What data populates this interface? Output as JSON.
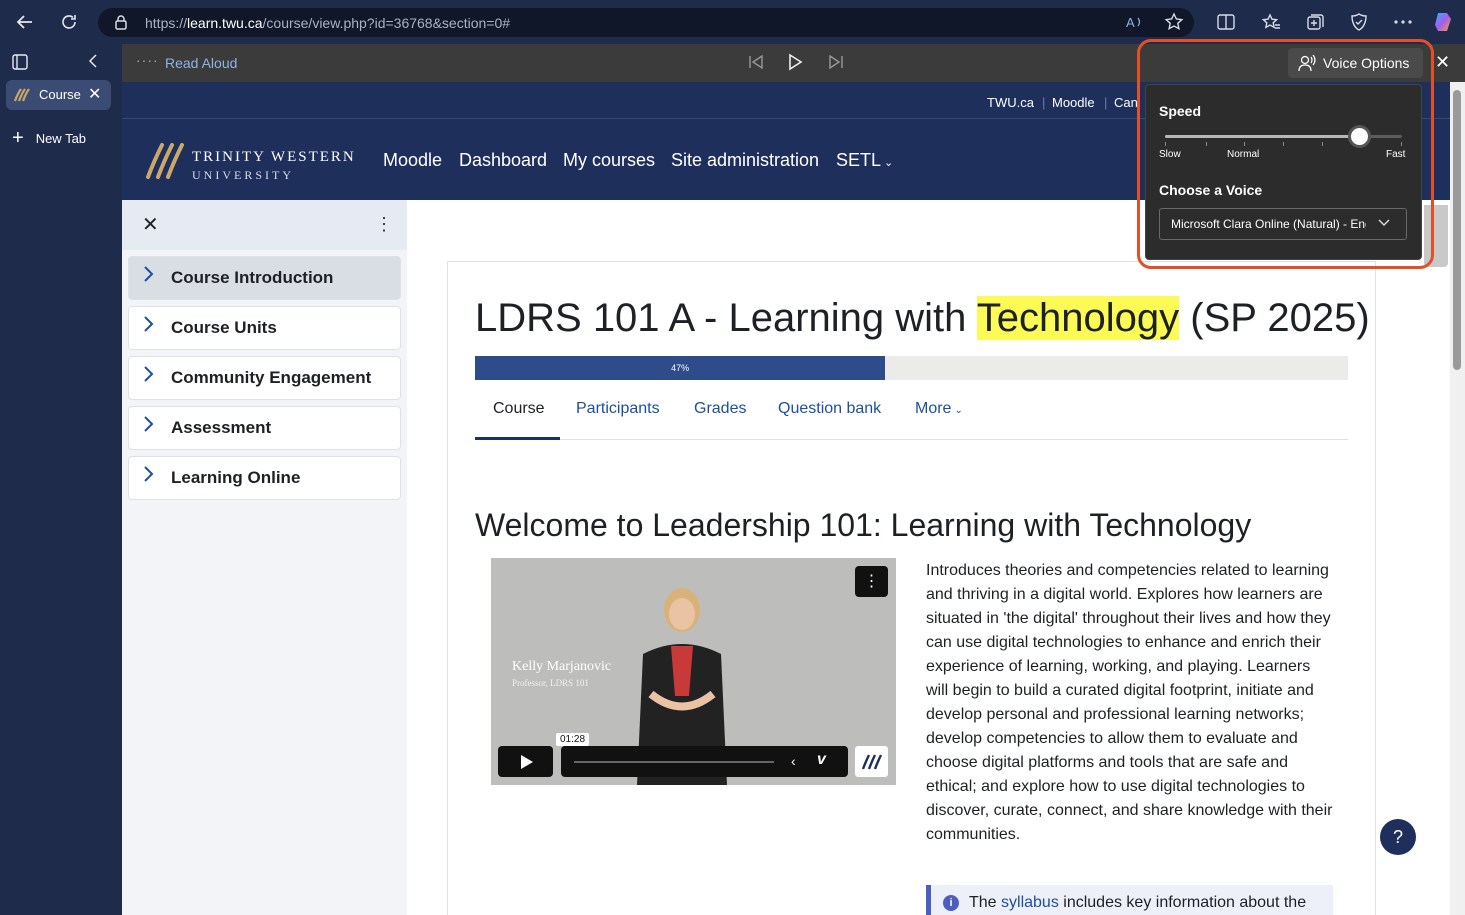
{
  "browser": {
    "url_prefix": "https://",
    "url_host": "learn.twu.ca",
    "url_path": "/course/view.php?id=36768&section=0#",
    "tabs": [
      {
        "label": "Course"
      }
    ],
    "new_tab_label": "New Tab"
  },
  "read_aloud": {
    "label": "Read Aloud",
    "voice_options_label": "Voice Options",
    "speed_label": "Speed",
    "speed_value": 0.82,
    "speed_marks": {
      "slow": "Slow",
      "normal": "Normal",
      "fast": "Fast"
    },
    "choose_voice_label": "Choose a Voice",
    "selected_voice": "Microsoft Clara Online (Natural) - English (Canada)"
  },
  "moodle": {
    "utility_links": [
      "TWU.ca",
      "Moodle",
      "Can"
    ],
    "logo_line1": "TRINITY WESTERN",
    "logo_line2": "UNIVERSITY",
    "nav": [
      "Moodle",
      "Dashboard",
      "My courses",
      "Site administration",
      "SETL"
    ],
    "course_index": [
      "Course Introduction",
      "Course Units",
      "Community Engagement",
      "Assessment",
      "Learning Online"
    ],
    "course_title_before": "LDRS 101 A - Learning with ",
    "course_title_highlight": "Technology",
    "course_title_after": " (SP 2025)",
    "progress_percent": 47,
    "progress_label": "47%",
    "tabs": [
      "Course",
      "Participants",
      "Grades",
      "Question bank",
      "More"
    ],
    "welcome_heading": "Welcome to Leadership 101: Learning with Technology",
    "video": {
      "presenter_name": "Kelly Marjanovic",
      "presenter_role": "Professor, LDRS 101",
      "time": "01:28"
    },
    "description": "Introduces theories and competencies related to learning and thriving in a digital world. Explores how learners are situated in 'the digital' throughout their lives and how they can use digital technologies to enhance and enrich their experience of learning, working, and playing. Learners will begin to build a curated digital footprint, initiate and develop personal and professional learning networks; develop competencies to allow them to evaluate and choose digital platforms and tools that are safe and ethical; and explore how to use digital technologies to discover, curate, connect, and share knowledge with their communities.",
    "syllabus_before": "The ",
    "syllabus_link": "syllabus",
    "syllabus_after": " includes key information about the",
    "help_label": "?"
  },
  "colors": {
    "accent": "#1e2f5c",
    "highlight": "#fcfb55",
    "ring": "#e2502a"
  }
}
